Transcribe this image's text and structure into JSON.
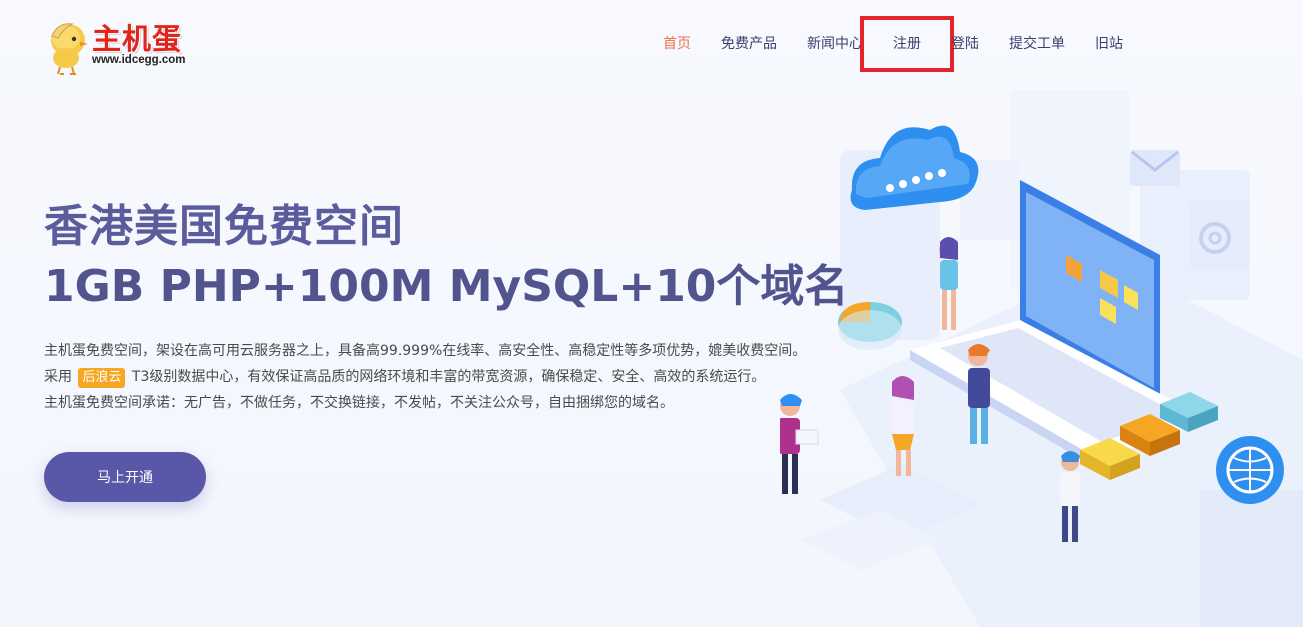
{
  "header": {
    "logo_text": "主机蛋",
    "logo_url": "www.idcegg.com",
    "nav": [
      {
        "label": "首页"
      },
      {
        "label": "免费产品"
      },
      {
        "label": "新闻中心"
      },
      {
        "label": "注册"
      },
      {
        "label": "登陆"
      },
      {
        "label": "提交工单"
      },
      {
        "label": "旧站"
      }
    ]
  },
  "hero": {
    "title": "香港美国免费空间",
    "subtitle": "1GB PHP+100M MySQL+10个域名",
    "desc_line1": "主机蛋免费空间，架设在高可用云服务器之上，具备高99.999%在线率、高安全性、高稳定性等多项优势，媲美收费空间。",
    "desc_line2_prefix": "采用",
    "desc_line2_badge": "后浪云",
    "desc_line2_suffix": "T3级别数据中心，有效保证高品质的网络环境和丰富的带宽资源，确保稳定、安全、高效的系统运行。",
    "desc_line3": "主机蛋免费空间承诺：无广告，不做任务，不交换链接，不发帖，不关注公众号，自由捆绑您的域名。",
    "cta_label": "马上开通"
  },
  "colors": {
    "nav_active": "#e9744d",
    "highlight_box": "#e3262b",
    "title": "#5a5c9c",
    "cta_bg": "#5957a8",
    "badge_bg": "#f6a623",
    "logo_red": "#e1251b"
  },
  "icons": [
    "chick-logo-icon",
    "cloud-icon",
    "mail-icon",
    "at-icon",
    "globe-icon"
  ]
}
